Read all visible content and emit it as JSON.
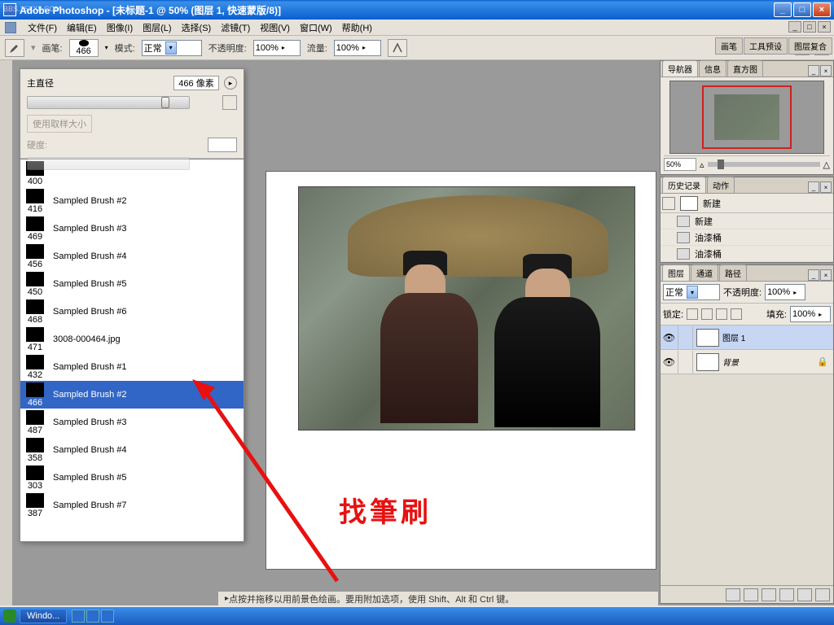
{
  "window": {
    "title": "Adobe Photoshop - [未标题-1 @ 50% (图层 1, 快速蒙版/8)]",
    "watermark": "BBS.16XX8.COM"
  },
  "menu": {
    "file": "文件(F)",
    "edit": "编辑(E)",
    "image": "图像(I)",
    "layer": "图层(L)",
    "select": "选择(S)",
    "filter": "滤镜(T)",
    "view": "视图(V)",
    "window": "窗口(W)",
    "help": "帮助(H)"
  },
  "options": {
    "brush_label": "画笔:",
    "brush_size": "466",
    "mode_label": "模式:",
    "mode_value": "正常",
    "opacity_label": "不透明度:",
    "opacity_value": "100%",
    "flow_label": "流量:",
    "flow_value": "100%"
  },
  "brush_tabs": {
    "brushes": "画笔",
    "tool_presets": "工具预设",
    "layer_comps": "图层复合"
  },
  "brush_panel": {
    "master_diameter_label": "主直径",
    "master_diameter_value": "466 像素",
    "use_sampled_size": "使用取样大小",
    "hardness_label": "硬度:",
    "brushes": [
      {
        "size": "400",
        "name": ""
      },
      {
        "size": "416",
        "name": "Sampled Brush #2"
      },
      {
        "size": "469",
        "name": "Sampled Brush #3"
      },
      {
        "size": "456",
        "name": "Sampled Brush #4"
      },
      {
        "size": "450",
        "name": "Sampled Brush #5"
      },
      {
        "size": "468",
        "name": "Sampled Brush #6"
      },
      {
        "size": "471",
        "name": "3008-000464.jpg"
      },
      {
        "size": "432",
        "name": "Sampled Brush #1"
      },
      {
        "size": "466",
        "name": "Sampled Brush #2",
        "selected": true
      },
      {
        "size": "487",
        "name": "Sampled Brush #3"
      },
      {
        "size": "358",
        "name": "Sampled Brush #4"
      },
      {
        "size": "303",
        "name": "Sampled Brush #5"
      },
      {
        "size": "387",
        "name": "Sampled Brush #7"
      }
    ]
  },
  "navigator": {
    "tab1": "导航器",
    "tab2": "信息",
    "tab3": "直方图",
    "zoom": "50%"
  },
  "history": {
    "tab1": "历史记录",
    "tab2": "动作",
    "doc": "新建",
    "steps": [
      "新建",
      "油漆桶",
      "油漆桶"
    ]
  },
  "layers": {
    "tab1": "图层",
    "tab2": "通道",
    "tab3": "路径",
    "mode": "正常",
    "opacity_label": "不透明度:",
    "opacity": "100%",
    "lock_label": "锁定:",
    "fill_label": "填充:",
    "fill": "100%",
    "items": [
      {
        "name": "图层 1"
      },
      {
        "name": "背景"
      }
    ]
  },
  "status": "点按并拖移以用前景色绘画。要用附加选项，使用 Shift、Alt 和 Ctrl 键。",
  "annotation": "找筆刷",
  "taskbar": {
    "task": "Windo..."
  },
  "winctrl": {
    "min": "_",
    "max": "□",
    "close": "×"
  }
}
